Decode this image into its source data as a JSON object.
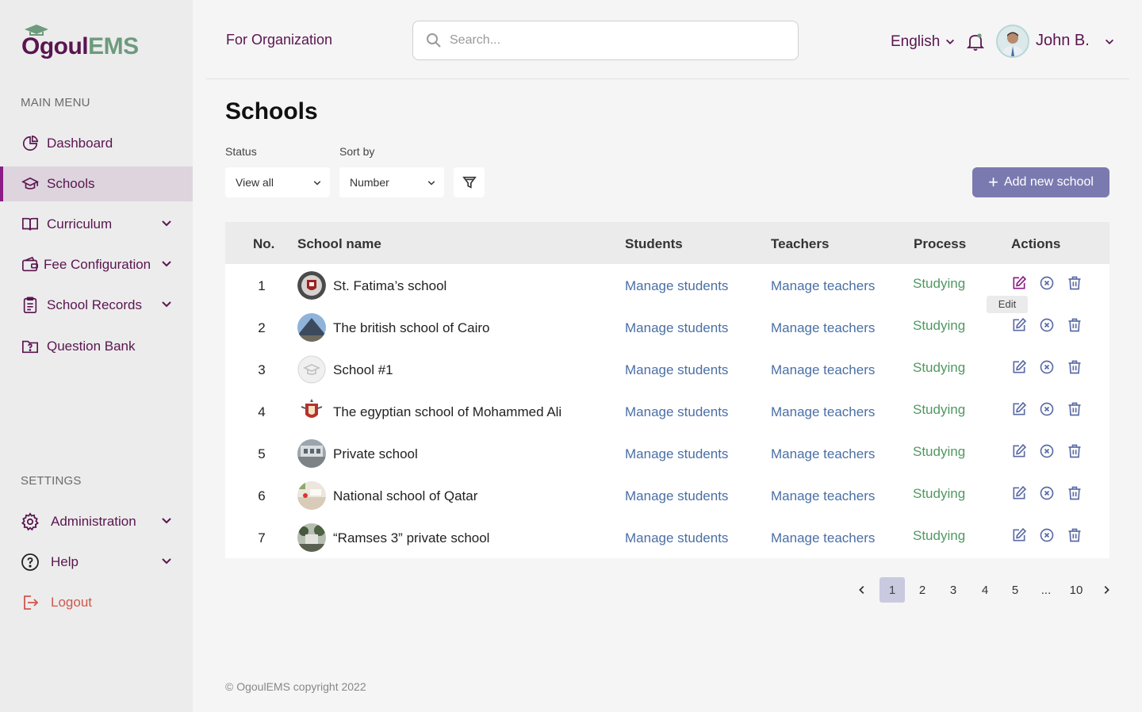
{
  "brand": {
    "part1": "Ogoul",
    "part2": "EMS"
  },
  "sidebar": {
    "main_label": "MAIN MENU",
    "items": [
      {
        "label": "Dashboard",
        "icon": "dashboard-icon"
      },
      {
        "label": "Schools",
        "icon": "school-icon"
      },
      {
        "label": "Curriculum",
        "icon": "book-icon"
      },
      {
        "label": "Fee Configuration",
        "icon": "wallet-icon"
      },
      {
        "label": "School Records",
        "icon": "records-icon"
      },
      {
        "label": "Question Bank",
        "icon": "question-folder-icon"
      }
    ],
    "settings_label": "SETTINGS",
    "settings_items": [
      {
        "label": "Administration",
        "icon": "gear-icon"
      },
      {
        "label": "Help",
        "icon": "help-icon"
      },
      {
        "label": "Logout",
        "icon": "logout-icon"
      }
    ]
  },
  "header": {
    "org": "For Organization",
    "search_placeholder": "Search...",
    "language": "English",
    "user": "John B."
  },
  "page": {
    "title": "Schools",
    "status_label": "Status",
    "status_value": "View all",
    "sort_label": "Sort by",
    "sort_value": "Number",
    "add_button": "Add new school"
  },
  "table": {
    "headers": {
      "no": "No.",
      "name": "School name",
      "students": "Students",
      "teachers": "Teachers",
      "process": "Process",
      "actions": "Actions"
    },
    "rows": [
      {
        "no": "1",
        "name": "St. Fatima’s school",
        "students": "Manage students",
        "teachers": "Manage teachers",
        "process": "Studying"
      },
      {
        "no": "2",
        "name": "The british school of Cairo",
        "students": "Manage students",
        "teachers": "Manage teachers",
        "process": "Studying"
      },
      {
        "no": "3",
        "name": "School #1",
        "students": "Manage students",
        "teachers": "Manage teachers",
        "process": "Studying"
      },
      {
        "no": "4",
        "name": "The egyptian school of Mohammed Ali",
        "students": "Manage students",
        "teachers": "Manage teachers",
        "process": "Studying"
      },
      {
        "no": "5",
        "name": "Private school",
        "students": "Manage students",
        "teachers": "Manage teachers",
        "process": "Studying"
      },
      {
        "no": "6",
        "name": "National school of Qatar",
        "students": "Manage students",
        "teachers": "Manage teachers",
        "process": "Studying"
      },
      {
        "no": "7",
        "name": "“Ramses 3” private school",
        "students": "Manage students",
        "teachers": "Manage teachers",
        "process": "Studying"
      }
    ],
    "tooltip": "Edit"
  },
  "pagination": {
    "pages": [
      "1",
      "2",
      "3",
      "4",
      "5",
      "...",
      "10"
    ],
    "current": "1"
  },
  "footer": "© OgoulEMS copyright 2022",
  "colors": {
    "brand": "#5a1550",
    "accent": "#8b1c86",
    "link": "#4a6fa5",
    "status": "#4f9960",
    "button": "#7b7ab0",
    "danger": "#d0574d"
  }
}
